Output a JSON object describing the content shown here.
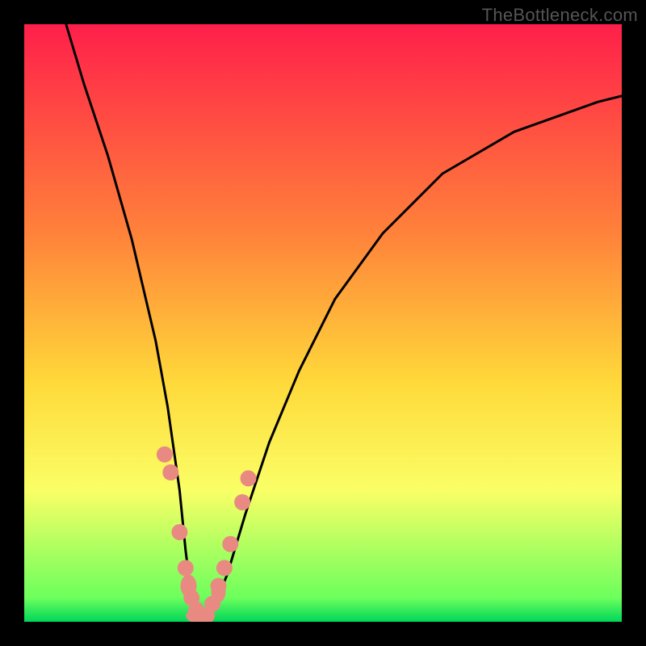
{
  "watermark": "TheBottleneck.com",
  "chart_data": {
    "type": "line",
    "title": "",
    "xlabel": "",
    "ylabel": "",
    "xlim": [
      0,
      100
    ],
    "ylim": [
      0,
      100
    ],
    "gradient_stops": [
      {
        "offset": 0,
        "color": "#ff1f4a"
      },
      {
        "offset": 35,
        "color": "#ff823a"
      },
      {
        "offset": 60,
        "color": "#ffd93a"
      },
      {
        "offset": 78,
        "color": "#faff66"
      },
      {
        "offset": 96,
        "color": "#6cff5c"
      },
      {
        "offset": 100,
        "color": "#00d65a"
      }
    ],
    "curve": {
      "x": [
        7,
        10,
        14,
        18,
        22,
        24,
        26,
        27,
        28,
        29,
        30,
        32,
        34,
        37,
        41,
        46,
        52,
        60,
        70,
        82,
        96,
        100
      ],
      "y": [
        100,
        90,
        78,
        64,
        47,
        36,
        22,
        12,
        4,
        1,
        1,
        3,
        8,
        18,
        30,
        42,
        54,
        65,
        75,
        82,
        87,
        88
      ]
    },
    "markers_x": [
      23.5,
      24.5,
      26.0,
      27.0,
      28.0,
      28.8,
      29.5,
      30.5,
      31.5,
      32.5,
      33.5,
      34.5,
      36.5,
      37.5
    ],
    "markers_y": [
      28,
      25,
      15,
      9,
      4,
      2,
      1,
      1,
      3,
      6,
      9,
      13,
      20,
      24
    ]
  }
}
